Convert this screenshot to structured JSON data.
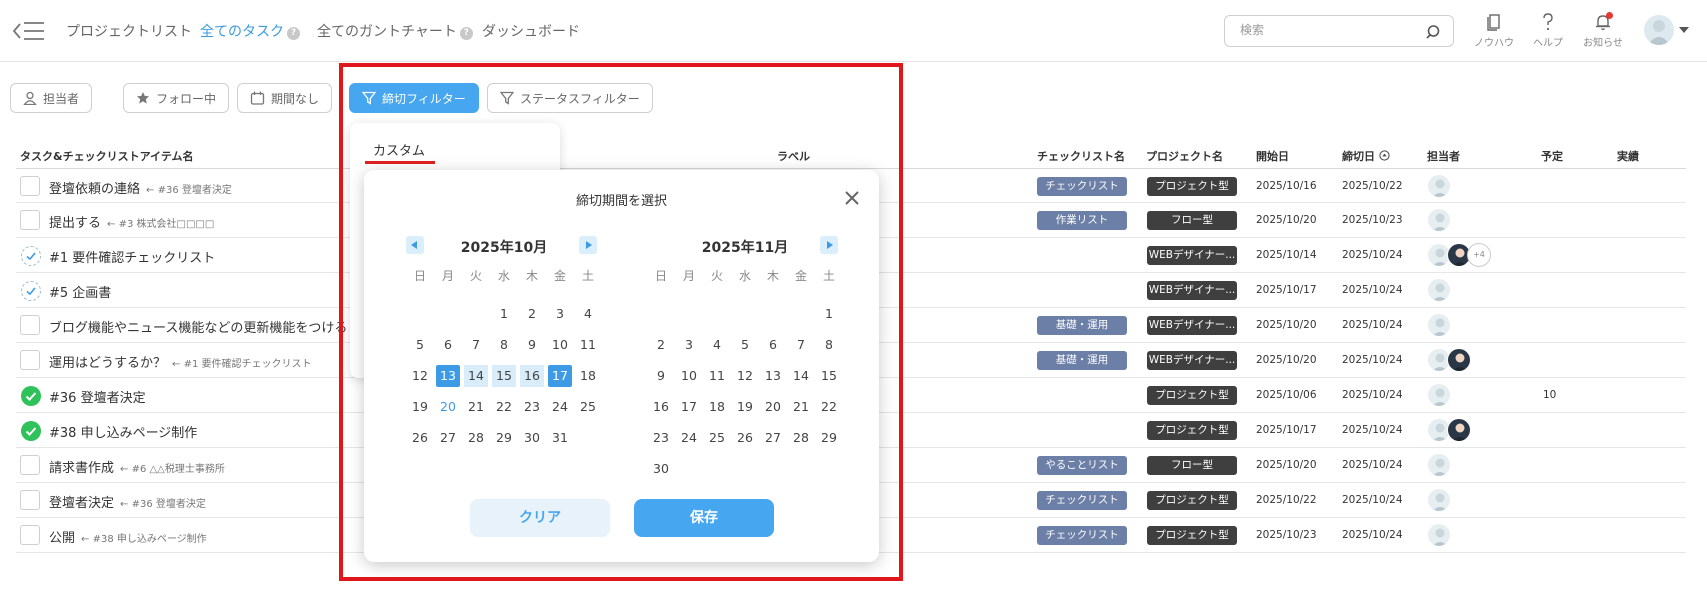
{
  "nav": {
    "items": [
      {
        "label": "プロジェクトリスト",
        "active": false,
        "help": false
      },
      {
        "label": "全てのタスク",
        "active": true,
        "help": true
      },
      {
        "label": "全てのガントチャート",
        "active": false,
        "help": true
      },
      {
        "label": "ダッシュボード",
        "active": false,
        "help": false
      }
    ],
    "help_mark": "?",
    "search_placeholder": "検索",
    "icons": [
      {
        "label": "ノウハウ",
        "icon": "book-icon"
      },
      {
        "label": "ヘルプ",
        "icon": "question-icon"
      },
      {
        "label": "お知らせ",
        "icon": "bell-icon"
      }
    ]
  },
  "filters": [
    {
      "label": "担当者",
      "icon": "person-icon",
      "active": false
    },
    {
      "label": "フォロー中",
      "icon": "star-icon",
      "active": false
    },
    {
      "label": "期間なし",
      "icon": "calendar-icon",
      "active": false
    },
    {
      "label": "締切フィルター",
      "icon": "filter-icon",
      "active": true
    },
    {
      "label": "ステータスフィルター",
      "icon": "filter-icon",
      "active": false
    }
  ],
  "table": {
    "headers": {
      "task": "タスク&チェックリストアイテム名",
      "label": "ラベル",
      "checklist": "チェックリスト名",
      "project": "プロジェクト名",
      "start": "開始日",
      "due": "締切日",
      "assignee": "担当者",
      "plan": "予定",
      "actual": "実績"
    },
    "rows": [
      {
        "status": "open",
        "name": "登壇依頼の連絡",
        "sub": "← #36 登壇者決定",
        "checklist": "チェックリスト",
        "project": "プロジェクト型",
        "start": "2025/10/16",
        "due": "2025/10/22",
        "assignees": 1,
        "more": "",
        "plan": ""
      },
      {
        "status": "open",
        "name": "提出する",
        "sub": "← #3 株式会社□□□□",
        "checklist": "作業リスト",
        "project": "フロー型",
        "start": "2025/10/20",
        "due": "2025/10/23",
        "assignees": 1,
        "more": "",
        "plan": ""
      },
      {
        "status": "partial",
        "name": "#1 要件確認チェックリスト",
        "sub": "",
        "checklist": "",
        "project": "WEBデザイナー...",
        "start": "2025/10/14",
        "due": "2025/10/24",
        "assignees": 2,
        "more": "+4",
        "plan": ""
      },
      {
        "status": "partial",
        "name": "#5 企画書",
        "sub": "",
        "checklist": "",
        "project": "WEBデザイナー...",
        "start": "2025/10/17",
        "due": "2025/10/24",
        "assignees": 1,
        "more": "",
        "plan": ""
      },
      {
        "status": "open",
        "name": "ブログ機能やニュース機能などの更新機能をつける",
        "sub": "",
        "checklist": "基礎・運用",
        "project": "WEBデザイナー...",
        "start": "2025/10/20",
        "due": "2025/10/24",
        "assignees": 1,
        "more": "",
        "plan": ""
      },
      {
        "status": "open",
        "name": "運用はどうするか？",
        "sub": "← #1 要件確認チェックリスト",
        "checklist": "基礎・運用",
        "project": "WEBデザイナー...",
        "start": "2025/10/20",
        "due": "2025/10/24",
        "assignees": 2,
        "more": "",
        "plan": ""
      },
      {
        "status": "done",
        "name": "#36 登壇者決定",
        "sub": "",
        "checklist": "",
        "project": "プロジェクト型",
        "start": "2025/10/06",
        "due": "2025/10/24",
        "assignees": 1,
        "more": "",
        "plan": "10"
      },
      {
        "status": "done",
        "name": "#38 申し込みページ制作",
        "sub": "",
        "checklist": "",
        "project": "プロジェクト型",
        "start": "2025/10/17",
        "due": "2025/10/24",
        "assignees": 2,
        "more": "",
        "plan": ""
      },
      {
        "status": "open",
        "name": "請求書作成",
        "sub": "← #6 △△税理士事務所",
        "checklist": "やることリスト",
        "project": "フロー型",
        "start": "2025/10/20",
        "due": "2025/10/24",
        "assignees": 1,
        "more": "",
        "plan": ""
      },
      {
        "status": "open",
        "name": "登壇者決定",
        "sub": "← #36 登壇者決定",
        "checklist": "チェックリスト",
        "project": "プロジェクト型",
        "start": "2025/10/22",
        "due": "2025/10/24",
        "assignees": 1,
        "more": "",
        "plan": ""
      },
      {
        "status": "open",
        "name": "公開",
        "sub": "← #38 申し込みページ制作",
        "checklist": "チェックリスト",
        "project": "プロジェクト型",
        "start": "2025/10/23",
        "due": "2025/10/24",
        "assignees": 1,
        "more": "",
        "plan": ""
      }
    ]
  },
  "dropdown": {
    "option": "カスタム"
  },
  "modal": {
    "title": "締切期間を選択",
    "weekdays": [
      "日",
      "月",
      "火",
      "水",
      "木",
      "金",
      "土"
    ],
    "months": [
      {
        "title": "2025年10月",
        "first_weekday": 3,
        "days": 31,
        "selected": [
          13,
          17
        ],
        "range": [
          14,
          15,
          16
        ],
        "today": 20
      },
      {
        "title": "2025年11月",
        "first_weekday": 6,
        "days": 30,
        "selected": [],
        "range": [],
        "today": null
      }
    ],
    "clear_label": "クリア",
    "save_label": "保存"
  }
}
